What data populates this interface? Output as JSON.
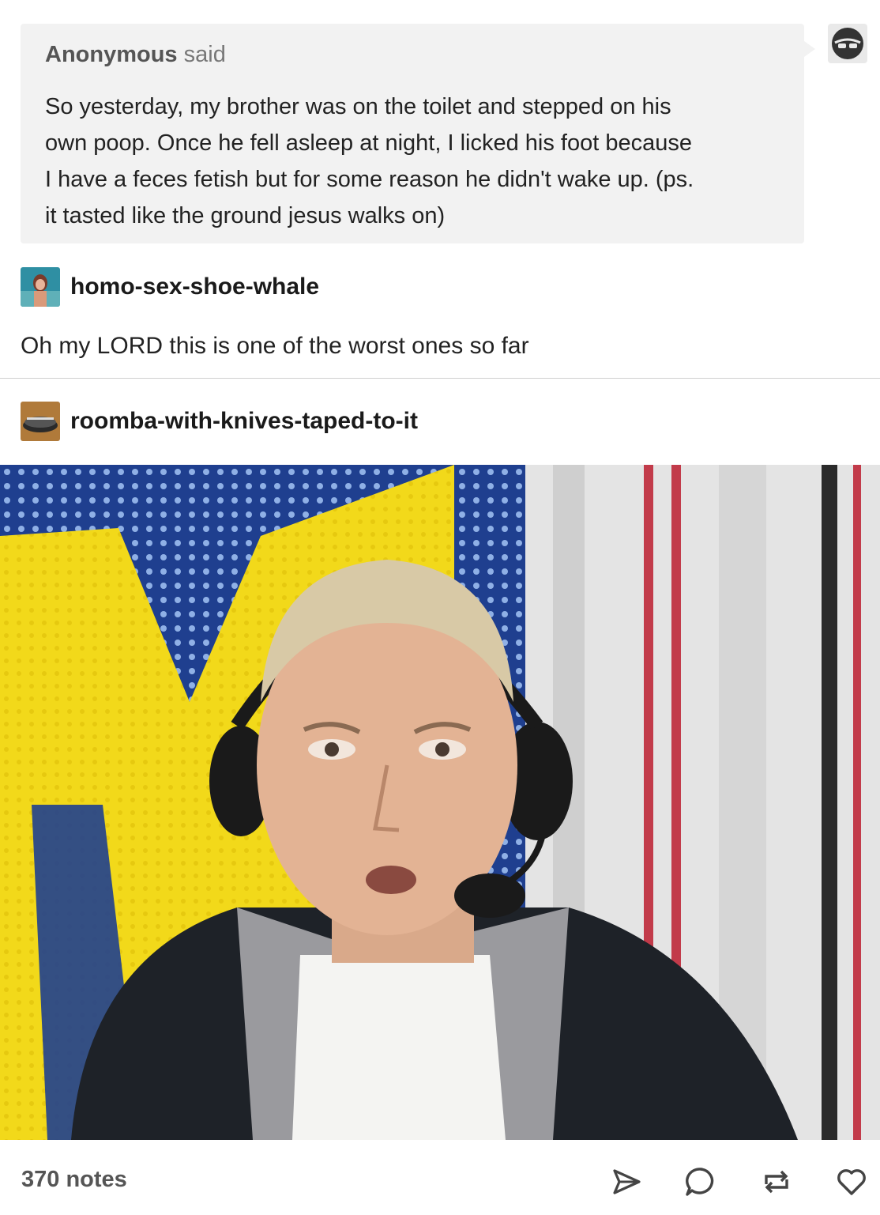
{
  "ask": {
    "asker_name": "Anonymous",
    "said": "said",
    "question_lines": [
      "So yesterday, my brother was on the toilet and stepped on his",
      "own poop. Once he fell asleep at night, I licked his foot because",
      "I have a feces fetish but for some reason he didn't wake up.  (ps.",
      "it tasted like the ground jesus walks on)"
    ]
  },
  "reblogs": [
    {
      "username": "homo-sex-shoe-whale",
      "text": "Oh my LORD this is one of the worst ones so far"
    },
    {
      "username": "roomba-with-knives-taped-to-it"
    }
  ],
  "footer": {
    "notes": "370 notes",
    "icons": [
      "send-icon",
      "comment-icon",
      "reblog-icon",
      "like-icon"
    ]
  }
}
